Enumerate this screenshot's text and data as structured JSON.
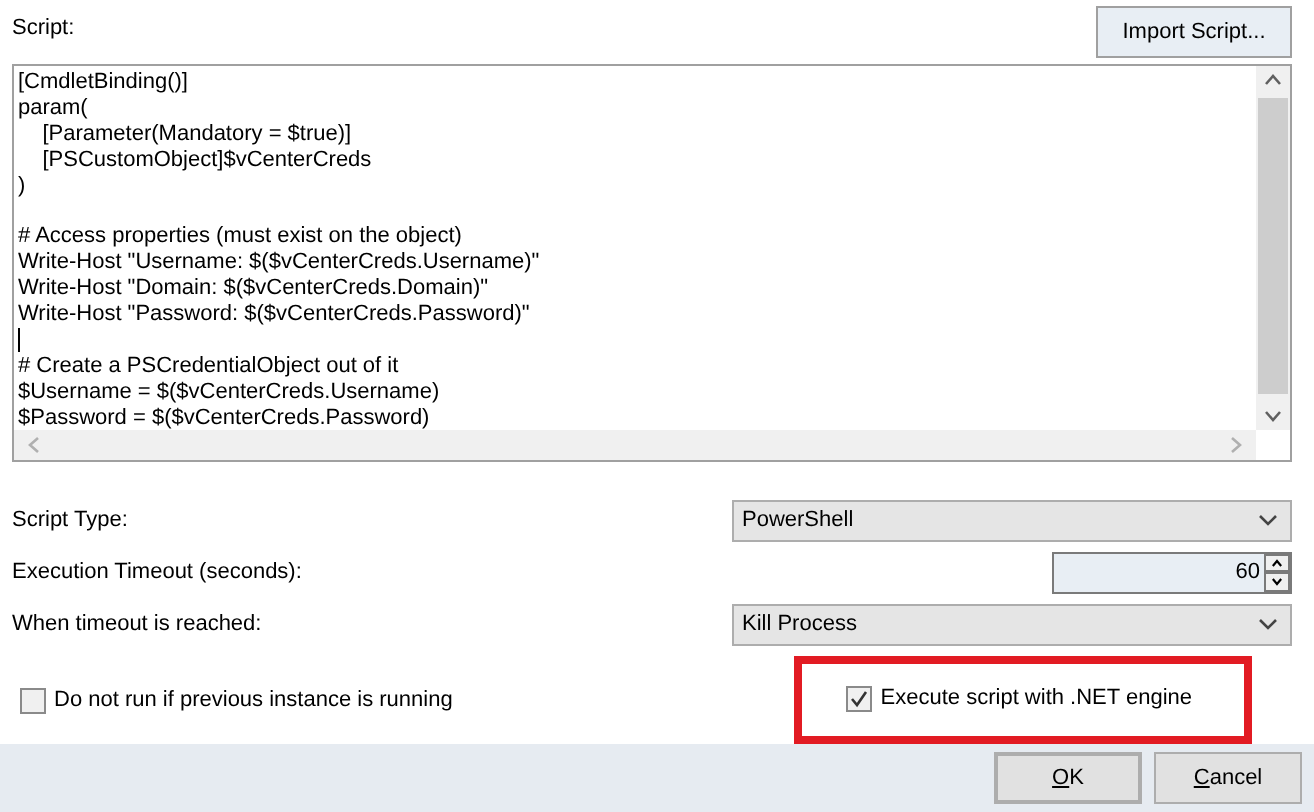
{
  "script": {
    "label": "Script:",
    "import_button": "Import Script...",
    "lines": [
      {
        "kind": "text",
        "text": "[CmdletBinding()]"
      },
      {
        "kind": "text",
        "text": "param("
      },
      {
        "kind": "text",
        "text": "    [Parameter(Mandatory = $true)]"
      },
      {
        "kind": "text",
        "text": "    [PSCustomObject]$vCenterCreds"
      },
      {
        "kind": "text",
        "text": ")"
      },
      {
        "kind": "blank"
      },
      {
        "kind": "text",
        "text": "# Access properties (must exist on the object)"
      },
      {
        "kind": "text",
        "text": "Write-Host \"Username: $($vCenterCreds.Username)\""
      },
      {
        "kind": "text",
        "text": "Write-Host \"Domain: $($vCenterCreds.Domain)\""
      },
      {
        "kind": "text",
        "text": "Write-Host \"Password: $($vCenterCreds.Password)\""
      },
      {
        "kind": "caret"
      },
      {
        "kind": "text",
        "text": "# Create a PSCredentialObject out of it"
      },
      {
        "kind": "text",
        "text": "$Username = $($vCenterCreds.Username)"
      },
      {
        "kind": "text",
        "text": "$Password = $($vCenterCreds.Password)"
      }
    ]
  },
  "fields": [
    {
      "kind": "dropdown",
      "label": "Script Type:",
      "value": "PowerShell"
    },
    {
      "kind": "spinner",
      "label": "Execution Timeout (seconds):",
      "value": "60"
    },
    {
      "kind": "dropdown",
      "label": "When timeout is reached:",
      "value": "Kill Process"
    }
  ],
  "checkboxes": [
    {
      "label": "Do not run if previous instance is running",
      "checked": false,
      "highlighted": false
    },
    {
      "label": "Execute script with .NET engine",
      "checked": true,
      "highlighted": true
    }
  ],
  "buttons": [
    {
      "label": "OK",
      "default": true,
      "mnemonic_underlined": true
    },
    {
      "label": "Cancel",
      "default": false,
      "mnemonic_underlined": true
    }
  ]
}
